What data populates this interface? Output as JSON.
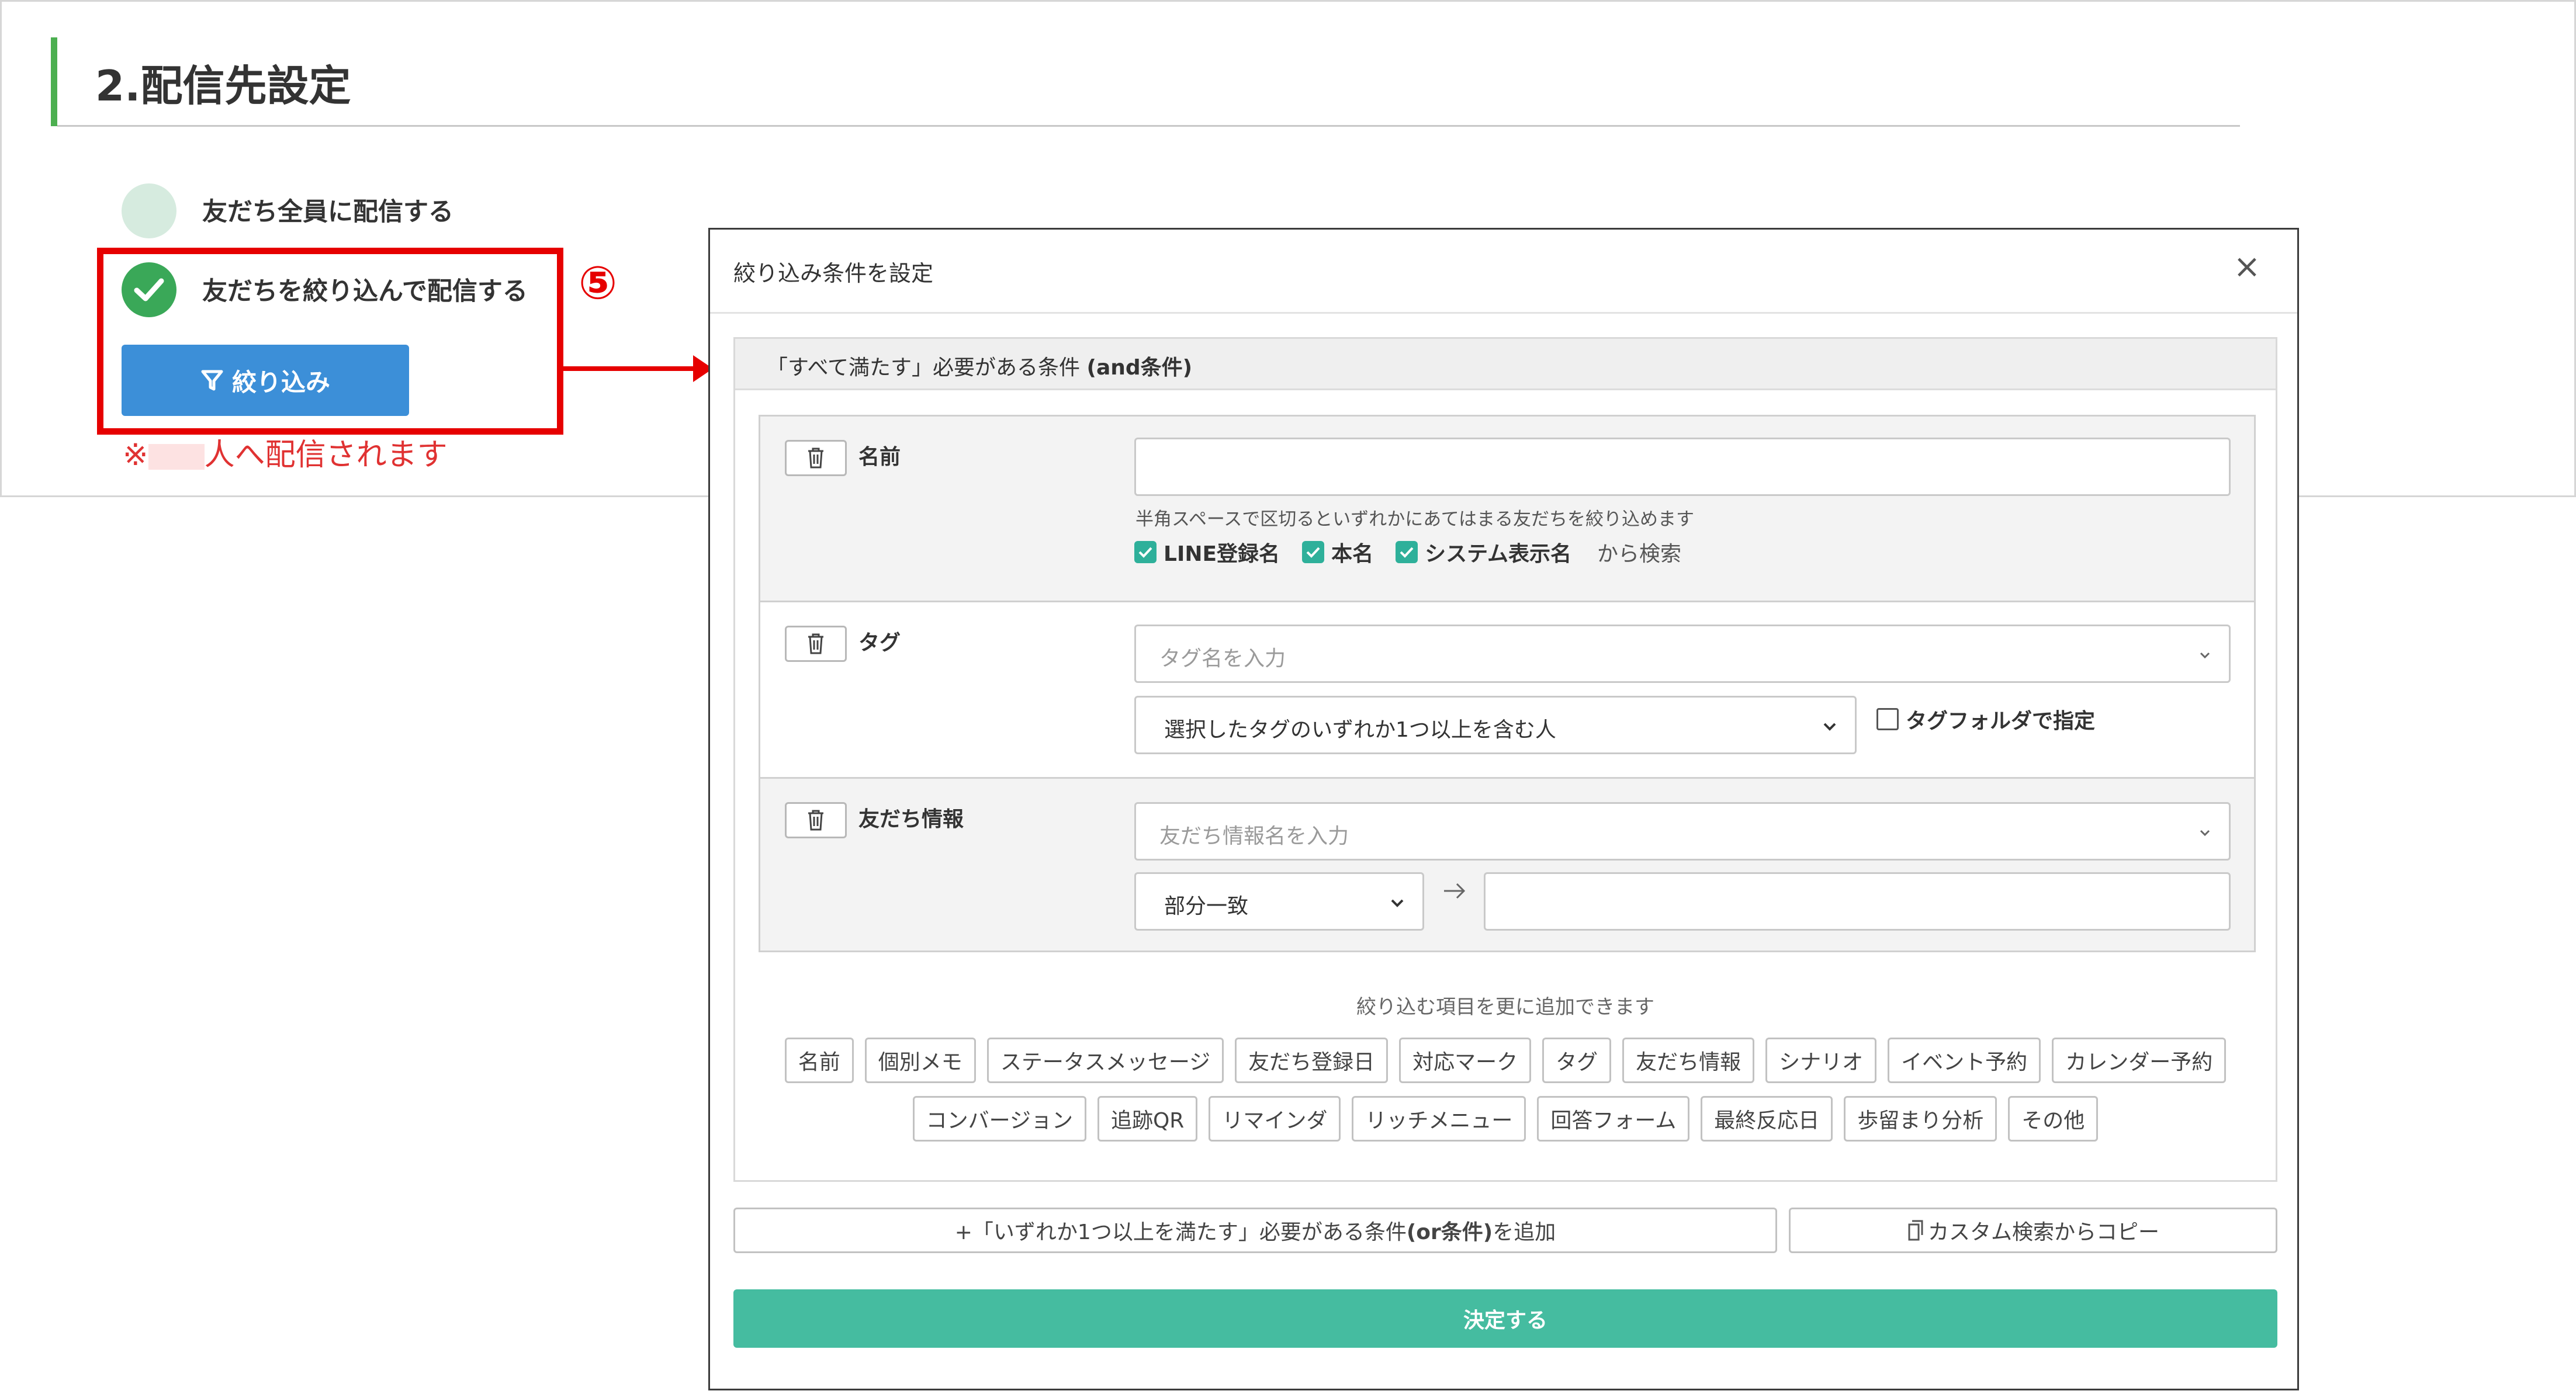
{
  "section": {
    "title": "2.配信先設定",
    "options": [
      {
        "label": "友だち全員に配信する",
        "selected": false
      },
      {
        "label": "友だちを絞り込んで配信する",
        "selected": true
      }
    ],
    "filter_button_label": "絞り込み",
    "delivery_note_prefix": "※",
    "delivery_note_suffix": "人へ配信されます"
  },
  "annotation": {
    "step_number": "⑤",
    "highlight_color": "#e60000"
  },
  "modal": {
    "title": "絞り込み条件を設定",
    "close_icon": "×",
    "and_group": {
      "label_main": "「すべて満たす」必要がある条件",
      "label_bold": "(and条件)"
    },
    "conditions": {
      "name": {
        "label": "名前",
        "input_value": "",
        "hint": "半角スペースで区切るといずれかにあてはまる友だちを絞り込めます",
        "checks": [
          {
            "label": "LINE登録名",
            "checked": true
          },
          {
            "label": "本名",
            "checked": true
          },
          {
            "label": "システム表示名",
            "checked": true
          }
        ],
        "suffix": "から検索"
      },
      "tag": {
        "label": "タグ",
        "placeholder": "タグ名を入力",
        "mode_value": "選択したタグのいずれか1つ以上を含む人",
        "folder_label": "タグフォルダで指定",
        "folder_checked": false
      },
      "friend_info": {
        "label": "友だち情報",
        "placeholder": "友だち情報名を入力",
        "match_value": "部分一致",
        "value_input": ""
      }
    },
    "add_hint": "絞り込む項目を更に追加できます",
    "chips_row1": [
      "名前",
      "個別メモ",
      "ステータスメッセージ",
      "友だち登録日",
      "対応マーク",
      "タグ",
      "友だち情報",
      "シナリオ",
      "イベント予約",
      "カレンダー予約"
    ],
    "chips_row2": [
      "コンバージョン",
      "追跡QR",
      "リマインダ",
      "リッチメニュー",
      "回答フォーム",
      "最終反応日",
      "歩留まり分析",
      "その他"
    ],
    "or_add_button": {
      "prefix": "+「いずれか1つ以上を満たす」必要がある条件",
      "bold": "(or条件)",
      "suffix": "を追加"
    },
    "copy_button_label": "カスタム検索からコピー",
    "confirm_button_label": "決定する"
  },
  "colors": {
    "accent_green": "#4caf50",
    "primary_blue": "#3c8fd8",
    "confirm_teal": "#45bca0",
    "checkbox_teal": "#2eb09a",
    "annotation_red": "#e60000"
  },
  "icons": {
    "filter_button": "funnel-icon",
    "trash": "trash-icon",
    "close": "close-icon",
    "chevron": "chevron-down-icon",
    "arrow": "arrow-right-icon",
    "copy": "copy-icon",
    "check": "check-icon"
  }
}
